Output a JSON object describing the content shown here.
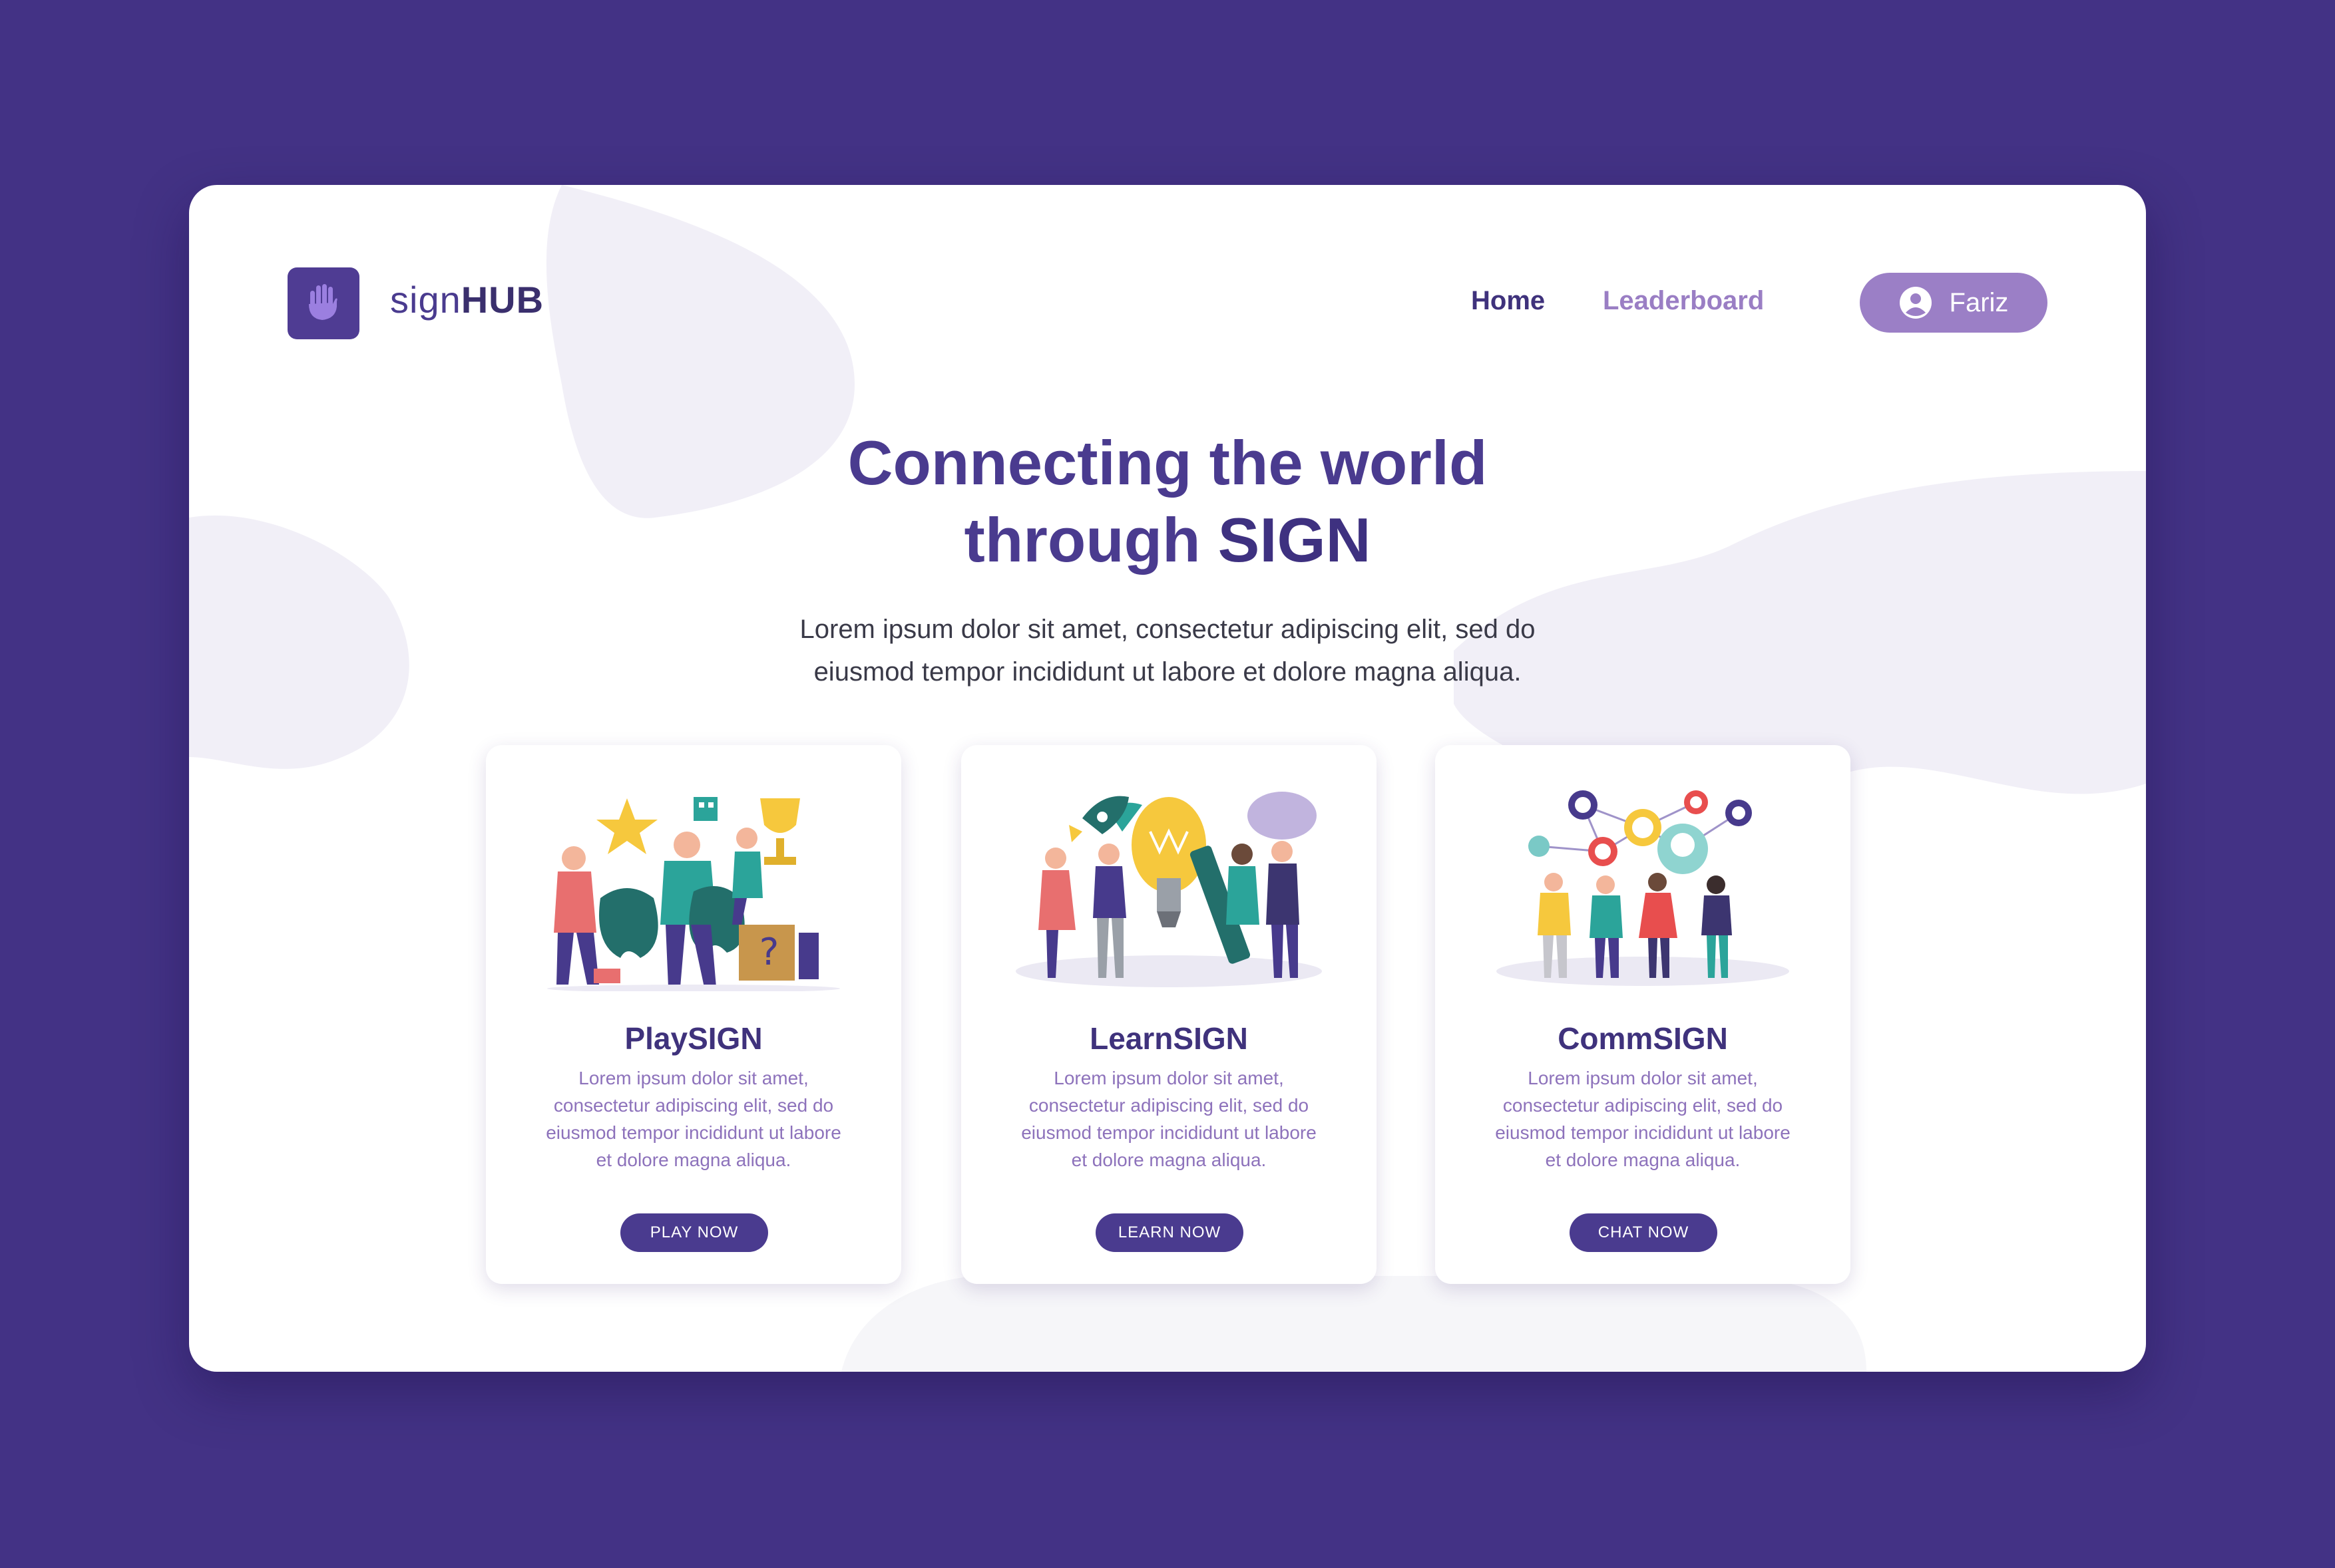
{
  "brand": {
    "name_light": "sign",
    "name_bold": "HUB",
    "logo_icon": "hand-icon"
  },
  "nav": {
    "home": "Home",
    "leaderboard": "Leaderboard"
  },
  "user": {
    "name": "Fariz",
    "icon": "user-circle-icon"
  },
  "hero": {
    "title_line1": "Connecting the world",
    "title_line2_prefix": "through ",
    "title_line2_bold": "SIGN",
    "subtitle_line1": "Lorem ipsum dolor sit amet, consectetur adipiscing elit, sed do",
    "subtitle_line2": "eiusmod tempor incididunt ut labore et dolore magna aliqua."
  },
  "cards": [
    {
      "title": "PlaySIGN",
      "desc": [
        "Lorem ipsum dolor sit amet,",
        "consectetur adipiscing elit, sed do",
        "eiusmod tempor incididunt ut labore",
        "et dolore magna aliqua."
      ],
      "button": "PLAY NOW",
      "illustration": "people-gaming-illustration"
    },
    {
      "title": "LearnSIGN",
      "desc": [
        "Lorem ipsum dolor sit amet,",
        "consectetur adipiscing elit, sed do",
        "eiusmod tempor incididunt ut labore",
        "et dolore magna aliqua."
      ],
      "button": "LEARN NOW",
      "illustration": "people-learning-illustration"
    },
    {
      "title": "CommSIGN",
      "desc": [
        "Lorem ipsum dolor sit amet,",
        "consectetur adipiscing elit, sed do",
        "eiusmod tempor incididunt ut labore",
        "et dolore magna aliqua."
      ],
      "button": "CHAT NOW",
      "illustration": "people-network-illustration"
    }
  ],
  "colors": {
    "background": "#433285",
    "primary": "#4a3b8f",
    "accent": "#9b7fc6",
    "blob": "#f1eff7"
  }
}
